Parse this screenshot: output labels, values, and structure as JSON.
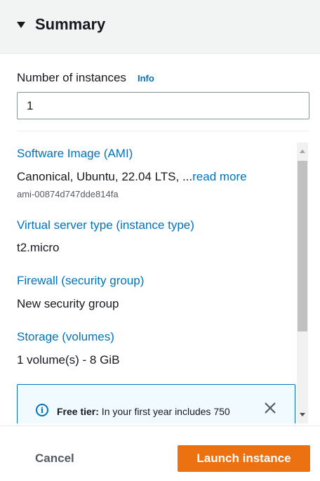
{
  "header": {
    "title": "Summary"
  },
  "instances": {
    "label": "Number of instances",
    "info": "Info",
    "value": "1"
  },
  "sections": {
    "ami": {
      "title": "Software Image (AMI)",
      "value": "Canonical, Ubuntu, 22.04 LTS, ...",
      "read_more": "read more",
      "sub": "ami-00874d747dde814fa"
    },
    "instance_type": {
      "title": "Virtual server type (instance type)",
      "value": "t2.micro"
    },
    "firewall": {
      "title": "Firewall (security group)",
      "value": "New security group"
    },
    "storage": {
      "title": "Storage (volumes)",
      "value": "1 volume(s) - 8 GiB"
    }
  },
  "alert": {
    "bold": "Free tier:",
    "text": " In your first year includes 750"
  },
  "footer": {
    "cancel": "Cancel",
    "launch": "Launch instance"
  },
  "colors": {
    "link": "#0073bb",
    "primary": "#ec7211",
    "header_bg": "#f2f3f3"
  }
}
